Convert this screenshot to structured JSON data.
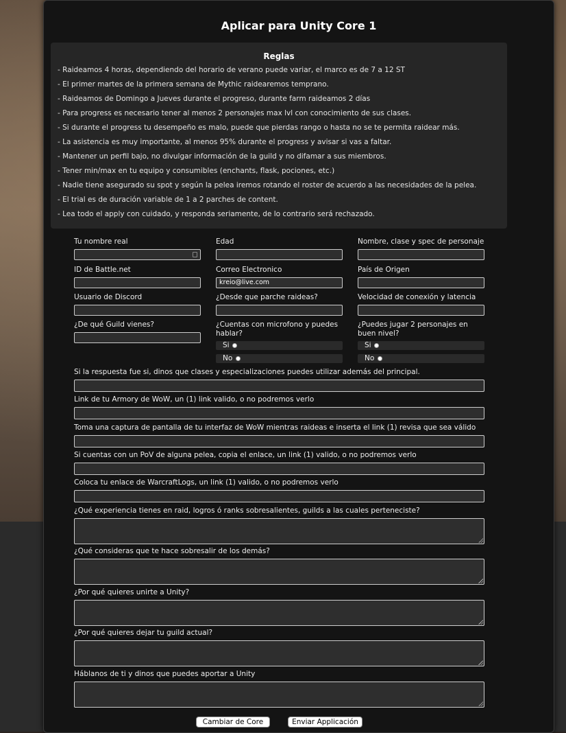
{
  "title": "Aplicar para Unity Core 1",
  "rules": {
    "heading": "Reglas",
    "items": [
      "- Raideamos 4 horas, dependiendo del horario de verano puede variar, el marco es de 7 a 12 ST",
      "- El primer martes de la primera semana de Mythic raidearemos temprano.",
      "- Raideamos de Domingo a Jueves durante el progreso, durante farm raideamos 2 días",
      "- Para progress es necesario tener al menos 2 personajes max lvl con conocimiento de sus clases.",
      "- Si durante el progress tu desempeño es malo, puede que pierdas rango o hasta no se te permita raidear más.",
      "- La asistencia es muy importante, al menos 95% durante el progress y avisar si vas a faltar.",
      "- Mantener un perfil bajo, no divulgar información de la guild y no difamar a sus miembros.",
      "- Tener min/max en tu equipo y consumibles (enchants, flask, pociones, etc.)",
      "- Nadie tiene asegurado su spot y según la pelea iremos rotando el roster de acuerdo a las necesidades de la pelea.",
      "- El trial es de duración variable de 1 a 2 parches de content.",
      "- Lea todo el apply con cuidado, y responda seriamente, de lo contrario será rechazado."
    ]
  },
  "fields": {
    "real_name": "Tu nombre real",
    "age": "Edad",
    "character": "Nombre, clase y spec de personaje",
    "battlenet": "ID de Battle.net",
    "email": "Correo Electronico",
    "email_value": "kreio@live.com",
    "country": "País de Origen",
    "discord": "Usuario de Discord",
    "since_patch": "¿Desde que parche raideas?",
    "connection": "Velocidad de conexión y latencia",
    "prev_guild": "¿De qué Guild vienes?",
    "microphone": "¿Cuentas con microfono y puedes hablar?",
    "two_chars": "¿Puedes jugar 2 personajes en buen nivel?",
    "yes": "Si",
    "no": "No",
    "if_yes": "Si la respuesta fue si, dinos que clases y especializaciones puedes utilizar además del principal.",
    "armory": "Link de tu Armory de WoW, un (1) link valido, o no podremos verlo",
    "screenshot": "Toma una captura de pantalla de tu interfaz de WoW mientras raideas e inserta el link (1) revisa que sea válido",
    "pov": "Si cuentas con un PoV de alguna pelea, copia el enlace, un link (1) valido, o no podremos verlo",
    "warcraftlogs": "Coloca tu enlace de WarcraftLogs, un link (1) valido, o no podremos verlo",
    "experience": "¿Qué experiencia tienes en raid, logros ó ranks sobresalientes, guilds a las cuales perteneciste?",
    "stand_out": "¿Qué consideras que te hace sobresalir de los demás?",
    "why_join": "¿Por qué quieres unirte a Unity?",
    "why_leave": "¿Por qué quieres dejar tu guild actual?",
    "about_you": "Háblanos de ti y dinos que puedes aportar a Unity"
  },
  "buttons": {
    "change_core": "Cambiar de Core",
    "submit": "Enviar Applicación"
  }
}
